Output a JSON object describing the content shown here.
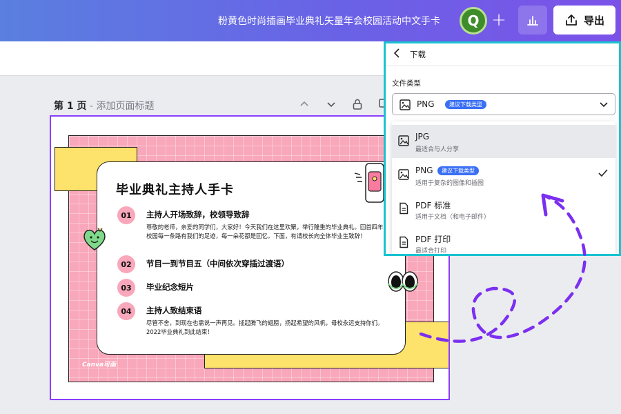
{
  "topbar": {
    "doc_title": "粉黄色时尚插画毕业典礼矢量年会校园活动中文手卡",
    "avatar_letter": "Q",
    "plus": "+",
    "export_label": "导出"
  },
  "page": {
    "number_label": "第 1 页",
    "separator": " - ",
    "title_placeholder": "添加页面标题"
  },
  "host_card": {
    "title": "毕业典礼主持人手卡",
    "items": [
      {
        "num": "01",
        "title": "主持人开场致辞，校领导致辞",
        "body": "尊敬的老师，亲爱的同学们，大家好！今天我们在这里欢聚，举行隆重的毕业典礼。回首四年，校园每一条路有我们的足迹，每一朵花都是回忆。下面，有请校长向全体毕业生致辞！"
      },
      {
        "num": "02",
        "title": "节目一到节目五（中间依次穿插过渡语）",
        "body": ""
      },
      {
        "num": "03",
        "title": "毕业纪念短片",
        "body": ""
      },
      {
        "num": "04",
        "title": "主持人致结束语",
        "body": "尽管不舍，到现在也需说一声再见。插起腾飞的翅膀，扬起希望的风帆，母校永远支持你们。2022毕业典礼到此结束！"
      }
    ],
    "logo_text": "Canva可画"
  },
  "download_panel": {
    "title": "下载",
    "file_type_label": "文件类型",
    "selected": "PNG",
    "recommended_badge": "建议下载类型",
    "options": [
      {
        "name": "JPG",
        "desc": "最适合与人分享",
        "badge": "",
        "checked": false,
        "highlighted": true
      },
      {
        "name": "PNG",
        "desc": "适用于复杂的图像和插图",
        "badge": "建议下载类型",
        "checked": true,
        "highlighted": false
      },
      {
        "name": "PDF 标准",
        "desc": "适用于文档（和电子邮件）",
        "badge": "",
        "checked": false,
        "highlighted": false
      },
      {
        "name": "PDF 打印",
        "desc": "最适合打印",
        "badge": "",
        "checked": false,
        "highlighted": false
      }
    ]
  },
  "colors": {
    "accent_purple": "#8b3dff",
    "panel_highlight": "#19c3cf",
    "badge_blue": "#3a6ff5",
    "pink": "#f9a7ba",
    "yellow": "#fde36b"
  }
}
